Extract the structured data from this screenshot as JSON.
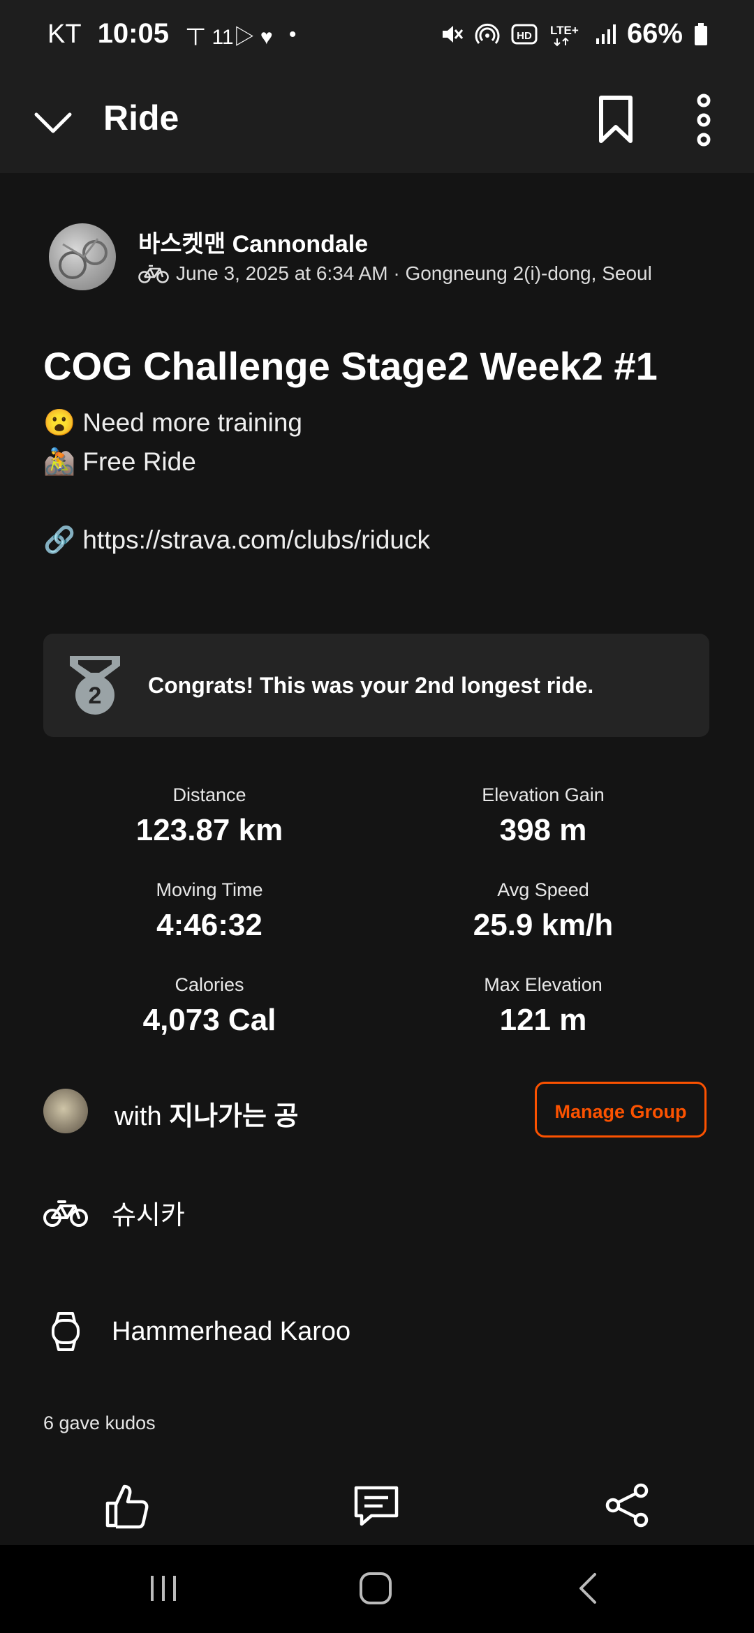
{
  "status_bar": {
    "carrier": "KT",
    "time": "10:05",
    "extra_icons": "ㄒ 11▷ ♥",
    "battery_percent": "66%"
  },
  "app_bar": {
    "title": "Ride"
  },
  "activity": {
    "athlete_name": "바스켓맨 Cannondale",
    "meta": "June 3, 2025 at 6:34 AM · Gongneung 2(i)-dong, Seoul",
    "title": "COG Challenge Stage2 Week2 #1",
    "description_lines": [
      "😮 Need more training",
      "🚵 Free Ride",
      "",
      "🔗 https://strava.com/clubs/riduck"
    ],
    "achievement": "Congrats! This was your 2nd longest ride.",
    "achievement_rank": "2"
  },
  "stats": [
    {
      "label": "Distance",
      "value": "123.87 km"
    },
    {
      "label": "Elevation Gain",
      "value": "398 m"
    },
    {
      "label": "Moving Time",
      "value": "4:46:32"
    },
    {
      "label": "Avg Speed",
      "value": "25.9 km/h"
    },
    {
      "label": "Calories",
      "value": "4,073 Cal"
    },
    {
      "label": "Max Elevation",
      "value": "121 m"
    }
  ],
  "group": {
    "with_prefix": "with",
    "with_name": "지나가는 공",
    "manage_label": "Manage Group"
  },
  "gear": {
    "bike": "슈시카",
    "device": "Hammerhead Karoo"
  },
  "kudos_text": "6 gave kudos",
  "colors": {
    "accent": "#fc5200",
    "background": "#141414",
    "appbar": "#1e1e1e",
    "card": "#242424"
  }
}
